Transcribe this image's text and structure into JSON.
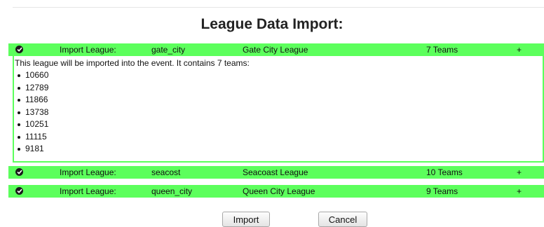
{
  "title": "League Data Import:",
  "leagues": [
    {
      "label": "Import League:",
      "id": "gate_city",
      "name": "Gate City League",
      "teams": "7 Teams",
      "toggle": "+"
    },
    {
      "label": "Import League:",
      "id": "seacost",
      "name": "Seacoast League",
      "teams": "10 Teams",
      "toggle": "+"
    },
    {
      "label": "Import League:",
      "id": "queen_city",
      "name": "Queen City League",
      "teams": "9 Teams",
      "toggle": "+"
    }
  ],
  "detail": {
    "description": "This league will be imported into the event. It contains 7 teams:",
    "team_numbers": [
      "10660",
      "12789",
      "11866",
      "13738",
      "10251",
      "11115",
      "9181"
    ]
  },
  "buttons": {
    "import": "Import",
    "cancel": "Cancel"
  },
  "colors": {
    "row_background": "#5cff5c",
    "check_icon": "#1a1a1a"
  }
}
